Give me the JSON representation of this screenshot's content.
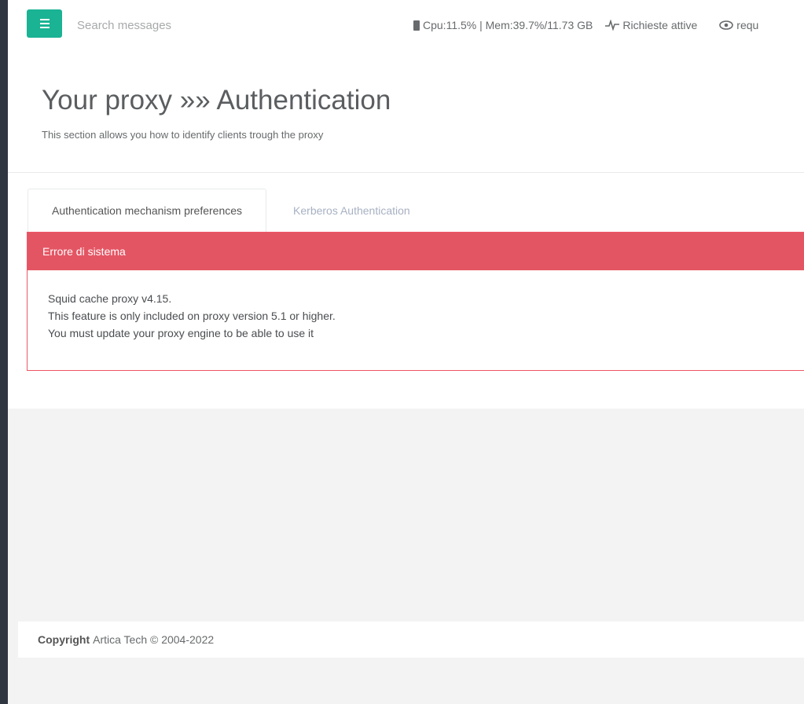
{
  "topbar": {
    "search_placeholder": "Search messages",
    "stats_text": "Cpu:11.5% | Mem:39.7%/11.73 GB",
    "active_requests_label": "Richieste attive",
    "requests_label": "requ"
  },
  "header": {
    "title": "Your proxy »» Authentication",
    "subtitle": "This section allows you how to identify clients trough the proxy"
  },
  "tabs": [
    {
      "label": "Authentication mechanism preferences",
      "active": true
    },
    {
      "label": "Kerberos Authentication",
      "active": false
    }
  ],
  "alert": {
    "heading": "Errore di sistema",
    "lines": [
      "Squid cache proxy v4.15.",
      "This feature is only included on proxy version 5.1 or higher.",
      "You must update your proxy engine to be able to use it"
    ]
  },
  "footer": {
    "copyright_label": "Copyright",
    "copyright_text": "Artica Tech © 2004-2022"
  },
  "colors": {
    "accent": "#1ab394",
    "danger": "#e45563",
    "sidebar": "#2f3640"
  },
  "icons": {
    "menu": "hamburger-icon",
    "cpu": "chip-icon",
    "activity": "pulse-icon",
    "eye": "eye-icon"
  }
}
